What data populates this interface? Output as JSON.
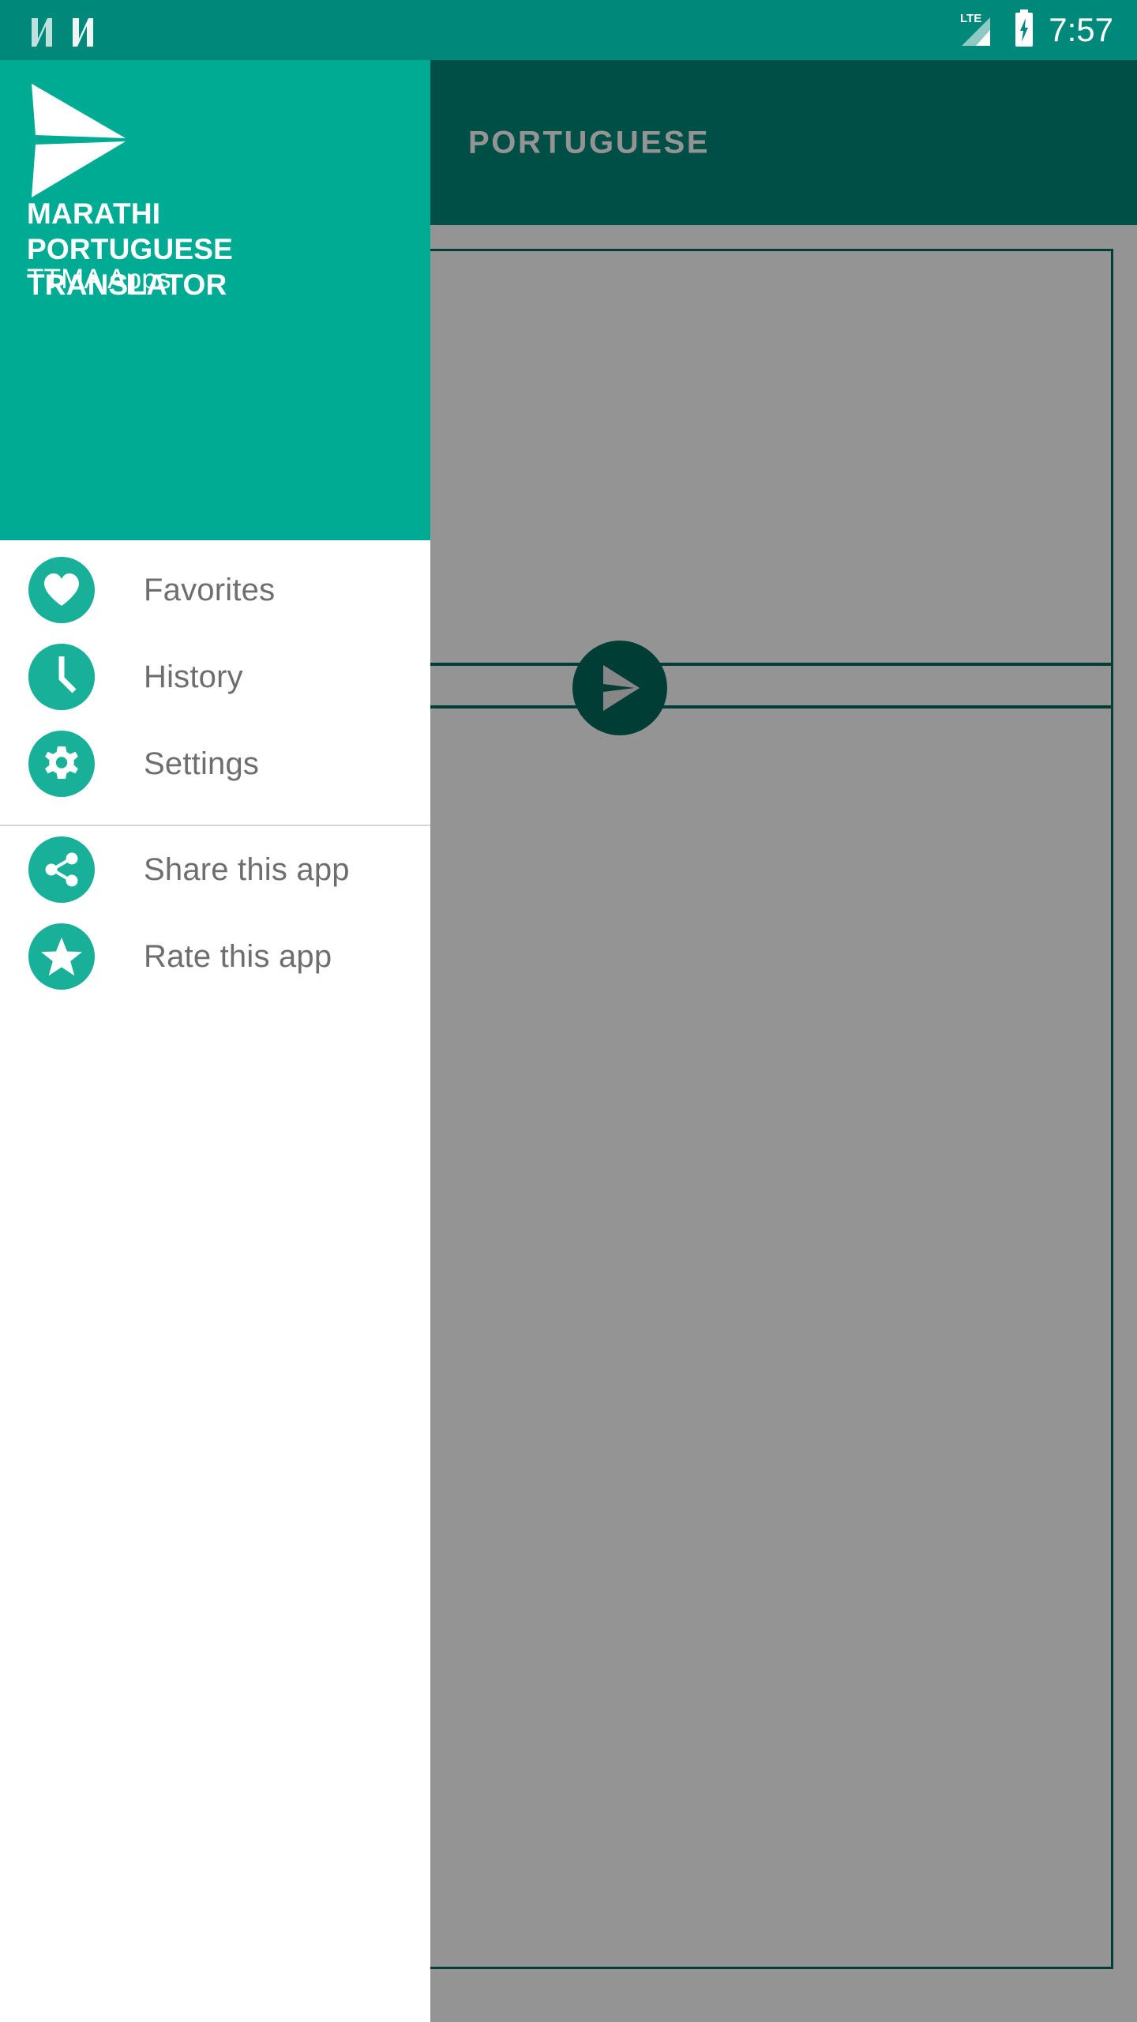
{
  "status_bar": {
    "notification_icons": [
      "notification-n-icon",
      "notification-n-icon"
    ],
    "network_label": "LTE",
    "signal_icon": "signal-bars-icon",
    "battery_icon": "battery-charging-icon",
    "time": "7:57",
    "background_color": "#00897b"
  },
  "app_bar": {
    "title": "PORTUGUESE",
    "background_color": "#00695c"
  },
  "content": {
    "send_button_icon": "send-icon",
    "text_card_border_color": "#00695c",
    "scrim_color": "rgba(0,0,0,0.42)"
  },
  "drawer": {
    "logo_icon": "paper-plane-send-logo",
    "title": "MARATHI PORTUGUESE TRANSLATOR",
    "subtitle": "TTMA Apps",
    "header_color": "#00ab94",
    "accent_color": "#19b09a",
    "groups": [
      {
        "items": [
          {
            "label": "Favorites",
            "icon": "heart-icon"
          },
          {
            "label": "History",
            "icon": "clock-icon"
          },
          {
            "label": "Settings",
            "icon": "gear-icon"
          }
        ]
      },
      {
        "items": [
          {
            "label": "Share this app",
            "icon": "share-icon"
          },
          {
            "label": "Rate this app",
            "icon": "star-icon"
          }
        ]
      }
    ]
  }
}
